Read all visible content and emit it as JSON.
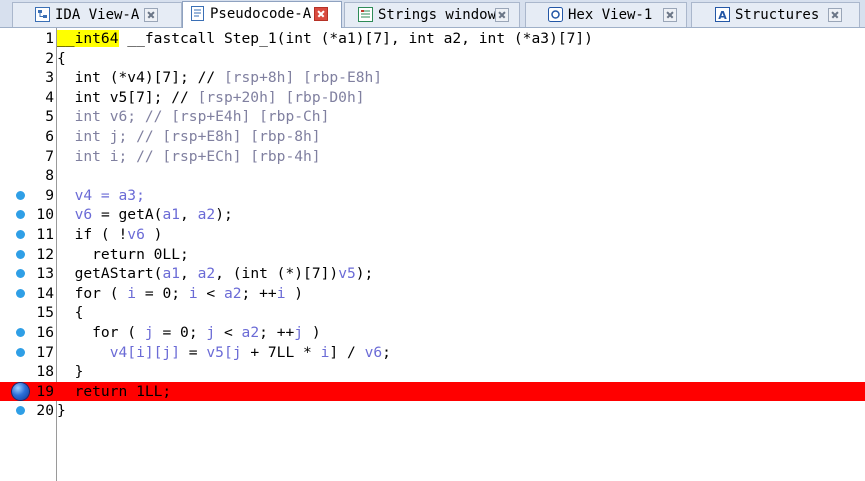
{
  "tabs": [
    {
      "name": "ida-view-tab",
      "label": "IDA View-A",
      "icon": "graph-view-icon",
      "active": false
    },
    {
      "name": "pseudocode-tab",
      "label": "Pseudocode-A",
      "icon": "pseudocode-icon",
      "active": true
    },
    {
      "name": "strings-tab",
      "label": "Strings window",
      "icon": "strings-icon",
      "active": false
    },
    {
      "name": "hex-view-tab",
      "label": "Hex View-1",
      "icon": "hex-view-icon",
      "active": false
    },
    {
      "name": "structures-tab",
      "label": "Structures",
      "icon": "structures-icon",
      "active": false
    }
  ],
  "lines": [
    {
      "n": "1",
      "dot": "none",
      "bp": false,
      "parts": [
        {
          "t": "__int64",
          "c": "hl-type"
        },
        {
          "t": " __fastcall Step_1(int (*a1)[7], int a2, int (*a3)[7])"
        }
      ]
    },
    {
      "n": "2",
      "dot": "none",
      "bp": false,
      "parts": [
        {
          "t": "{"
        }
      ]
    },
    {
      "n": "3",
      "dot": "none",
      "bp": false,
      "parts": [
        {
          "t": "  int (*v4)[7]; // "
        },
        {
          "t": "[rsp+8h] [rbp-E8h]",
          "c": "c-cm"
        }
      ]
    },
    {
      "n": "4",
      "dot": "none",
      "bp": false,
      "parts": [
        {
          "t": "  int v5[7]; // "
        },
        {
          "t": "[rsp+20h] [rbp-D0h]",
          "c": "c-cm"
        }
      ]
    },
    {
      "n": "5",
      "dot": "none",
      "bp": false,
      "parts": [
        {
          "t": "  int v6; // [rsp+E4h] [rbp-Ch]",
          "c": "c-cm"
        }
      ]
    },
    {
      "n": "6",
      "dot": "none",
      "bp": false,
      "parts": [
        {
          "t": "  int j; // [rsp+E8h] [rbp-8h]",
          "c": "c-cm"
        }
      ]
    },
    {
      "n": "7",
      "dot": "none",
      "bp": false,
      "parts": [
        {
          "t": "  int i; // [rsp+ECh] [rbp-4h]",
          "c": "c-cm"
        }
      ]
    },
    {
      "n": "8",
      "dot": "none",
      "bp": false,
      "parts": [
        {
          "t": ""
        }
      ]
    },
    {
      "n": "9",
      "dot": "small",
      "bp": false,
      "parts": [
        {
          "t": "  v4 = a3;",
          "c": "c-var"
        }
      ]
    },
    {
      "n": "10",
      "dot": "small",
      "bp": false,
      "parts": [
        {
          "t": "  v6",
          "c": "c-var"
        },
        {
          "t": " = getA("
        },
        {
          "t": "a1",
          "c": "c-var"
        },
        {
          "t": ", "
        },
        {
          "t": "a2",
          "c": "c-var"
        },
        {
          "t": ");"
        }
      ]
    },
    {
      "n": "11",
      "dot": "small",
      "bp": false,
      "parts": [
        {
          "t": "  if ( !"
        },
        {
          "t": "v6",
          "c": "c-var"
        },
        {
          "t": " )"
        }
      ]
    },
    {
      "n": "12",
      "dot": "small",
      "bp": false,
      "parts": [
        {
          "t": "    return 0LL;"
        }
      ]
    },
    {
      "n": "13",
      "dot": "small",
      "bp": false,
      "parts": [
        {
          "t": "  getAStart("
        },
        {
          "t": "a1",
          "c": "c-var"
        },
        {
          "t": ", "
        },
        {
          "t": "a2",
          "c": "c-var"
        },
        {
          "t": ", (int (*)[7])"
        },
        {
          "t": "v5",
          "c": "c-var"
        },
        {
          "t": ");"
        }
      ]
    },
    {
      "n": "14",
      "dot": "small",
      "bp": false,
      "parts": [
        {
          "t": "  for ( "
        },
        {
          "t": "i",
          "c": "c-var"
        },
        {
          "t": " = 0; "
        },
        {
          "t": "i",
          "c": "c-var"
        },
        {
          "t": " < "
        },
        {
          "t": "a2",
          "c": "c-var"
        },
        {
          "t": "; ++"
        },
        {
          "t": "i",
          "c": "c-var"
        },
        {
          "t": " )"
        }
      ]
    },
    {
      "n": "15",
      "dot": "none",
      "bp": false,
      "parts": [
        {
          "t": "  {"
        }
      ]
    },
    {
      "n": "16",
      "dot": "small",
      "bp": false,
      "parts": [
        {
          "t": "    for ( "
        },
        {
          "t": "j",
          "c": "c-var"
        },
        {
          "t": " = 0; "
        },
        {
          "t": "j",
          "c": "c-var"
        },
        {
          "t": " < "
        },
        {
          "t": "a2",
          "c": "c-var"
        },
        {
          "t": "; ++"
        },
        {
          "t": "j",
          "c": "c-var"
        },
        {
          "t": " )"
        }
      ]
    },
    {
      "n": "17",
      "dot": "small",
      "bp": false,
      "parts": [
        {
          "t": "      v4[i][j]",
          "c": "c-var"
        },
        {
          "t": " = "
        },
        {
          "t": "v5[j",
          "c": "c-var"
        },
        {
          "t": " + 7LL * "
        },
        {
          "t": "i",
          "c": "c-var"
        },
        {
          "t": "] / "
        },
        {
          "t": "v6",
          "c": "c-var"
        },
        {
          "t": ";"
        }
      ]
    },
    {
      "n": "18",
      "dot": "none",
      "bp": false,
      "parts": [
        {
          "t": "  }"
        }
      ]
    },
    {
      "n": "19",
      "dot": "big",
      "bp": true,
      "parts": [
        {
          "t": "  return 1LL;"
        }
      ]
    },
    {
      "n": "20",
      "dot": "small",
      "bp": false,
      "parts": [
        {
          "t": "}"
        }
      ]
    }
  ],
  "colors": {
    "breakpoint": "#ff0000",
    "dot": "#2f9fe6",
    "type_highlight": "#ffff00",
    "comment": "#8080a0",
    "variable": "#6b6bd6"
  }
}
